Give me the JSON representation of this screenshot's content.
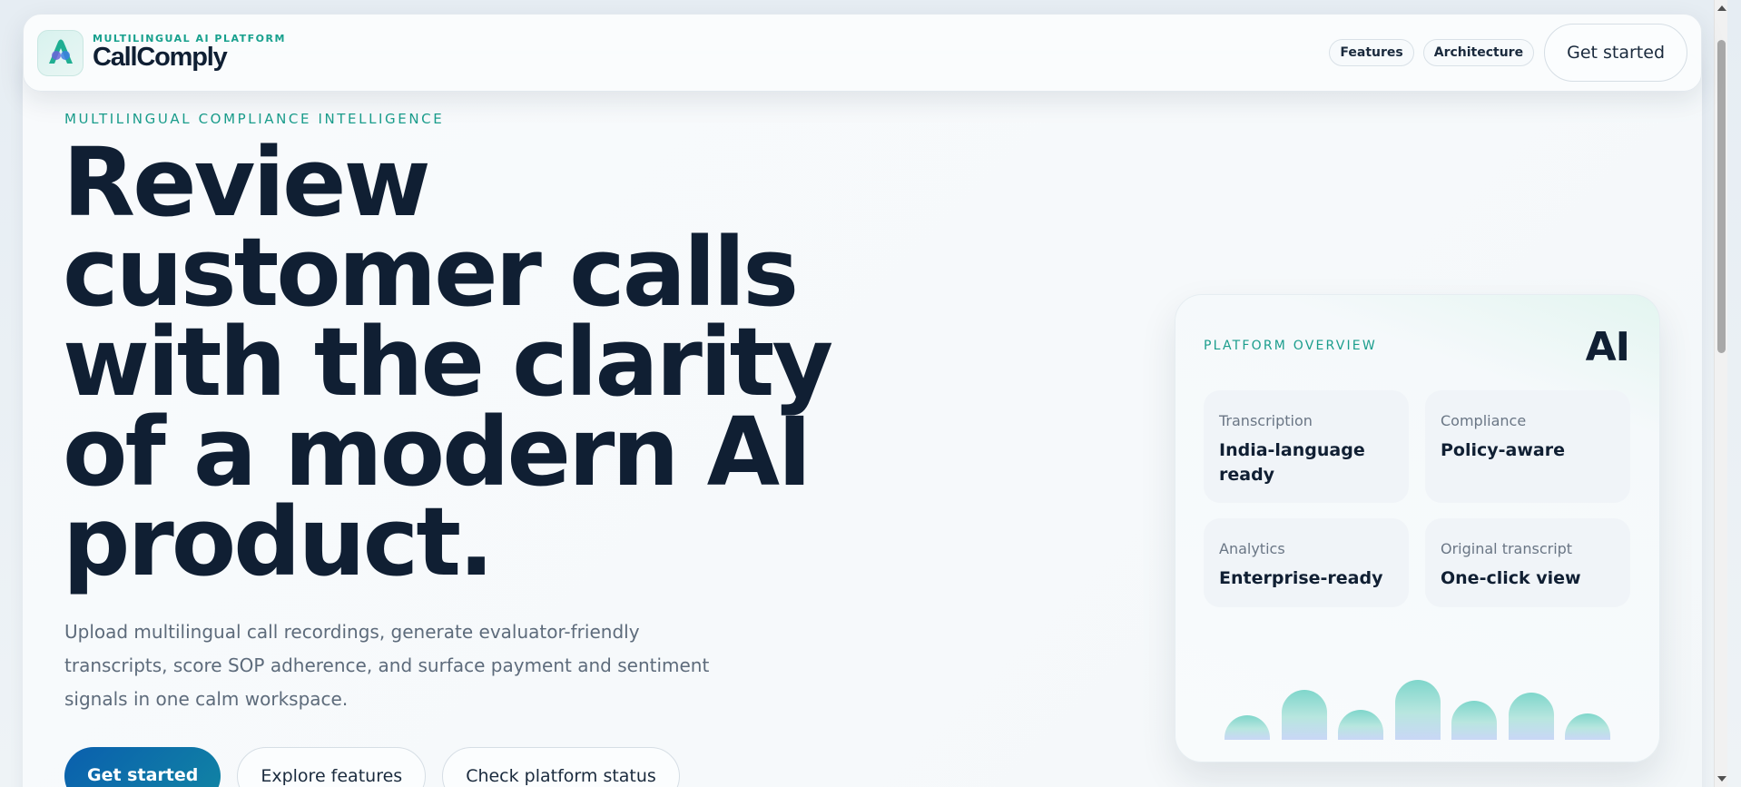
{
  "header": {
    "kicker": "MULTILINGUAL AI PLATFORM",
    "brand": "CallComply",
    "nav": [
      {
        "label": "Features"
      },
      {
        "label": "Architecture"
      }
    ],
    "cta": "Get started"
  },
  "hero": {
    "eyebrow": "MULTILINGUAL COMPLIANCE INTELLIGENCE",
    "headline": "Review customer calls with the clarity of a modern AI product.",
    "subcopy": "Upload multilingual call recordings, generate evaluator-friendly transcripts, score SOP adherence, and surface payment and sentiment signals in one calm workspace.",
    "buttons": {
      "primary": "Get started",
      "explore": "Explore features",
      "status": "Check platform status"
    }
  },
  "overview": {
    "eyebrow": "PLATFORM OVERVIEW",
    "badge": "AI",
    "tiles": [
      {
        "label": "Transcription",
        "value": "India-language ready"
      },
      {
        "label": "Compliance",
        "value": "Policy-aware"
      },
      {
        "label": "Analytics",
        "value": "Enterprise-ready"
      },
      {
        "label": "Original transcript",
        "value": "One-click view"
      }
    ],
    "bars": [
      0.27,
      0.55,
      0.33,
      0.66,
      0.43,
      0.52,
      0.29
    ]
  },
  "colors": {
    "accent": "#1a9d8c",
    "primary": "#0a5fae",
    "ink": "#101f33"
  }
}
